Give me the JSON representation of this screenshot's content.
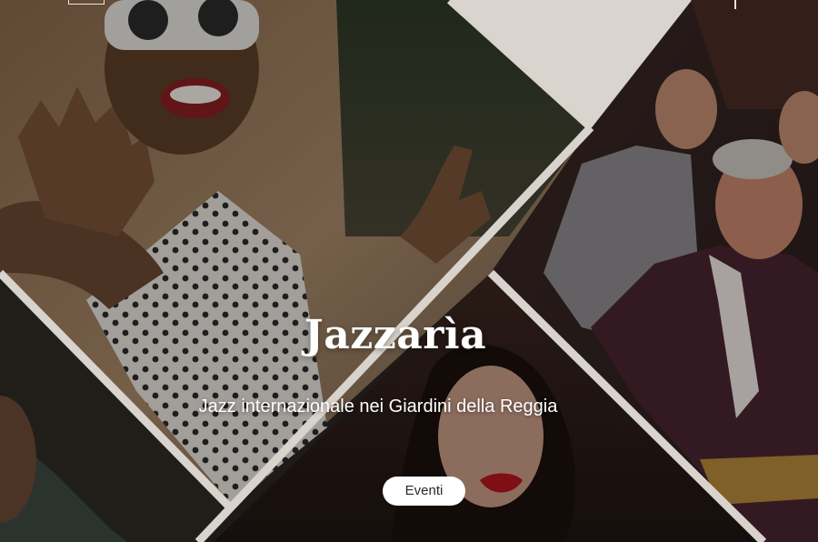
{
  "hero": {
    "title": "Jazzarìa",
    "subtitle": "Jazz internazionale nei Giardini della Reggia",
    "cta_label": "Eventi"
  },
  "colors": {
    "overlay": "#000000",
    "divider": "#d8d3cc",
    "button_bg": "#ffffff",
    "button_text": "#2b2b2b"
  }
}
